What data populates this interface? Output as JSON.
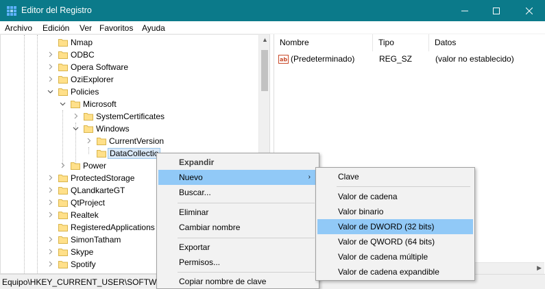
{
  "window": {
    "title": "Editor del Registro",
    "controls": {
      "minimize": "—",
      "maximize": "☐",
      "close": "✕"
    },
    "accent": "#0b7a8a"
  },
  "menubar": [
    "Archivo",
    "Edición",
    "Ver",
    "Favoritos",
    "Ayuda"
  ],
  "tree": [
    {
      "label": "Nmap",
      "expander": ""
    },
    {
      "label": "ODBC",
      "expander": ">"
    },
    {
      "label": "Opera Software",
      "expander": ">"
    },
    {
      "label": "OziExplorer",
      "expander": ">"
    },
    {
      "label": "Policies",
      "expander": "v"
    },
    {
      "label": "Microsoft",
      "expander": "v"
    },
    {
      "label": "SystemCertificates",
      "expander": ">"
    },
    {
      "label": "Windows",
      "expander": "v"
    },
    {
      "label": "CurrentVersion",
      "expander": ">"
    },
    {
      "label": "DataCollectio",
      "expander": ""
    },
    {
      "label": "Power",
      "expander": ">"
    },
    {
      "label": "ProtectedStorage",
      "expander": ">"
    },
    {
      "label": "QLandkarteGT",
      "expander": ">"
    },
    {
      "label": "QtProject",
      "expander": ">"
    },
    {
      "label": "Realtek",
      "expander": ">"
    },
    {
      "label": "RegisteredApplications",
      "expander": ""
    },
    {
      "label": "SimonTatham",
      "expander": ">"
    },
    {
      "label": "Skype",
      "expander": ">"
    },
    {
      "label": "Spotify",
      "expander": ">"
    }
  ],
  "list": {
    "columns": [
      "Nombre",
      "Tipo",
      "Datos"
    ],
    "rows": [
      {
        "name": "(Predeterminado)",
        "type": "REG_SZ",
        "data": "(valor no establecido)",
        "icon": "string-value-icon"
      }
    ]
  },
  "statusbar": {
    "path": "Equipo\\HKEY_CURRENT_USER\\SOFTWARE"
  },
  "context_menu": {
    "items": [
      "Expandir",
      "Nuevo",
      "Buscar...",
      "Eliminar",
      "Cambiar nombre",
      "Exportar",
      "Permisos...",
      "Copiar nombre de clave"
    ],
    "highlighted": "Nuevo",
    "submenu_arrow": "›"
  },
  "submenu": {
    "items": [
      "Clave",
      "Valor de cadena",
      "Valor binario",
      "Valor de DWORD (32 bits)",
      "Valor de QWORD (64 bits)",
      "Valor de cadena múltiple",
      "Valor de cadena expandible"
    ],
    "highlighted": "Valor de DWORD (32 bits)",
    "highlight_color": "#91c9f7"
  }
}
